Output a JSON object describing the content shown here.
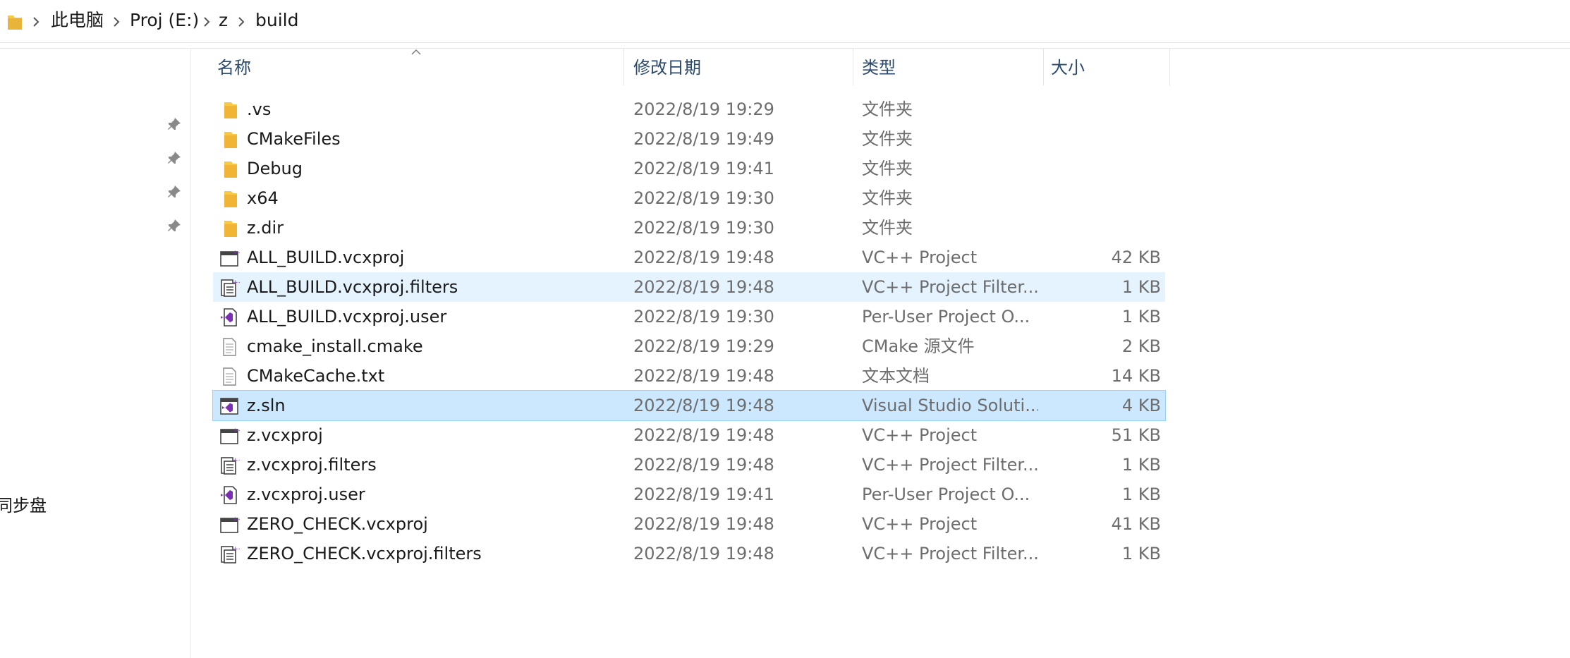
{
  "address_bar": {
    "crumbs": [
      "此电脑",
      "Proj (E:)",
      "z",
      "build"
    ]
  },
  "nav_pane": {
    "partial_label": "同步盘"
  },
  "columns": {
    "name": "名称",
    "date": "修改日期",
    "type": "类型",
    "size": "大小"
  },
  "files": [
    {
      "name": ".vs",
      "date": "2022/8/19 19:29",
      "type": "文件夹",
      "size": "",
      "icon": "folder-icon"
    },
    {
      "name": "CMakeFiles",
      "date": "2022/8/19 19:49",
      "type": "文件夹",
      "size": "",
      "icon": "folder-icon"
    },
    {
      "name": "Debug",
      "date": "2022/8/19 19:41",
      "type": "文件夹",
      "size": "",
      "icon": "folder-icon"
    },
    {
      "name": "x64",
      "date": "2022/8/19 19:30",
      "type": "文件夹",
      "size": "",
      "icon": "folder-icon"
    },
    {
      "name": "z.dir",
      "date": "2022/8/19 19:30",
      "type": "文件夹",
      "size": "",
      "icon": "folder-icon"
    },
    {
      "name": "ALL_BUILD.vcxproj",
      "date": "2022/8/19 19:48",
      "type": "VC++ Project",
      "size": "42 KB",
      "icon": "vcxproj-icon"
    },
    {
      "name": "ALL_BUILD.vcxproj.filters",
      "date": "2022/8/19 19:48",
      "type": "VC++ Project Filter...",
      "size": "1 KB",
      "icon": "filters-icon"
    },
    {
      "name": "ALL_BUILD.vcxproj.user",
      "date": "2022/8/19 19:30",
      "type": "Per-User Project O...",
      "size": "1 KB",
      "icon": "vs-user-icon"
    },
    {
      "name": "cmake_install.cmake",
      "date": "2022/8/19 19:29",
      "type": "CMake 源文件",
      "size": "2 KB",
      "icon": "text-file-icon"
    },
    {
      "name": "CMakeCache.txt",
      "date": "2022/8/19 19:48",
      "type": "文本文档",
      "size": "14 KB",
      "icon": "text-file-icon"
    },
    {
      "name": "z.sln",
      "date": "2022/8/19 19:48",
      "type": "Visual Studio Soluti...",
      "size": "4 KB",
      "icon": "sln-icon"
    },
    {
      "name": "z.vcxproj",
      "date": "2022/8/19 19:48",
      "type": "VC++ Project",
      "size": "51 KB",
      "icon": "vcxproj-icon"
    },
    {
      "name": "z.vcxproj.filters",
      "date": "2022/8/19 19:48",
      "type": "VC++ Project Filter...",
      "size": "1 KB",
      "icon": "filters-icon"
    },
    {
      "name": "z.vcxproj.user",
      "date": "2022/8/19 19:41",
      "type": "Per-User Project O...",
      "size": "1 KB",
      "icon": "vs-user-icon"
    },
    {
      "name": "ZERO_CHECK.vcxproj",
      "date": "2022/8/19 19:48",
      "type": "VC++ Project",
      "size": "41 KB",
      "icon": "vcxproj-icon"
    },
    {
      "name": "ZERO_CHECK.vcxproj.filters",
      "date": "2022/8/19 19:48",
      "type": "VC++ Project Filter...",
      "size": "1 KB",
      "icon": "filters-icon"
    }
  ],
  "state": {
    "hover_row": "ALL_BUILD.vcxproj.filters",
    "selected_row": "z.sln"
  },
  "colors": {
    "folder": "#f7c948",
    "hover": "#e5f3ff",
    "selected": "#cce8ff",
    "header_text": "#2b4a6e",
    "vs_purple": "#7b2fb5"
  }
}
